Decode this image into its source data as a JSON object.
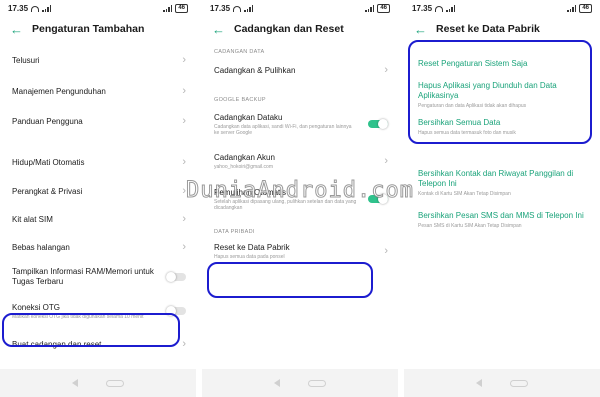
{
  "watermark": "DuniaAndroid.com",
  "colors": {
    "accent": "#1aa37a",
    "highlight": "#1c1ccf",
    "toggle_on": "#2fc28c"
  },
  "status_time": "17.35",
  "battery": "46",
  "panel1": {
    "title": "Pengaturan Tambahan",
    "items": [
      {
        "label": "Telusuri"
      },
      {
        "label": "Manajemen Pengunduhan"
      },
      {
        "label": "Panduan Pengguna"
      },
      {
        "label": "Hidup/Mati Otomatis"
      },
      {
        "label": "Perangkat & Privasi"
      },
      {
        "label": "Kit alat SIM"
      },
      {
        "label": "Bebas halangan"
      },
      {
        "label": "Tampilkan Informasi RAM/Memori untuk Tugas Terbaru"
      },
      {
        "label": "Koneksi OTG",
        "sub": "Matikan koneksi OTG jika tidak digunakan selama 10 menit"
      },
      {
        "label": "Buat cadangan dan reset"
      }
    ]
  },
  "panel2": {
    "title": "Cadangkan dan Reset",
    "section_data": "CADANGAN DATA",
    "section_google": "GOOGLE BACKUP",
    "section_private": "DATA PRIBADI",
    "items": [
      {
        "label": "Cadangkan & Pulihkan"
      },
      {
        "label": "Cadangkan Dataku",
        "sub": "Cadangkan data aplikasi, sandi Wi-Fi, dan pengaturan lainnya ke server Google"
      },
      {
        "label": "Cadangkan Akun",
        "sub": "yahoo_hokoiri@gmail.com"
      },
      {
        "label": "Pemulihan Otomatis",
        "sub": "Setelah aplikasi dipasang ulang, pulihkan setelan dan data yang dicadangkan"
      },
      {
        "label": "Reset ke Data Pabrik",
        "sub": "Hapus semua data pada ponsel"
      }
    ]
  },
  "panel3": {
    "title": "Reset ke Data Pabrik",
    "items": [
      {
        "label": "Reset Pengaturan Sistem Saja"
      },
      {
        "label": "Hapus Aplikasi yang Diunduh dan Data Aplikasinya",
        "sub": "Pengaturan dan data Aplikasi tidak akan dihapus"
      },
      {
        "label": "Bersihkan Semua Data",
        "sub": "Hapus semua data termasuk foto dan musik"
      },
      {
        "label": "Bersihkan Kontak dan Riwayat Panggilan di Telepon Ini",
        "sub": "Kontak di Kartu SIM Akan Tetap Disimpan"
      },
      {
        "label": "Bersihkan Pesan SMS dan MMS di Telepon Ini",
        "sub": "Pesan SMS di Kartu SIM Akan Tetap Disimpan"
      }
    ]
  }
}
